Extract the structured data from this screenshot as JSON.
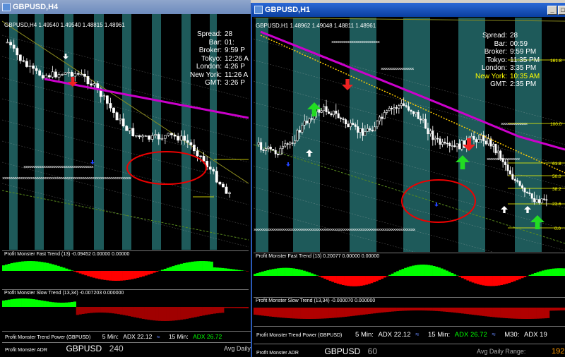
{
  "left_window": {
    "title": "GBPUSD,H4",
    "symbol_line": "GBPUSD,H4 1.49540 1.49540 1.48815 1.48961",
    "info": [
      {
        "label": "Spread:",
        "value": "28"
      },
      {
        "label": "Bar:",
        "value": "01:"
      },
      {
        "label": "Broker:",
        "value": "9:59 P"
      },
      {
        "label": "Tokyo:",
        "value": "12:26 A"
      },
      {
        "label": "London:",
        "value": "4:26 P"
      },
      {
        "label": "New York:",
        "value": "11:26 A"
      },
      {
        "label": "GMT:",
        "value": "3:26 P"
      }
    ],
    "fast_trend": {
      "label": "Profit Monster Fast Trend (13) -0.09452 0.00000 0.00000"
    },
    "slow_trend": {
      "label": "Profit Monster Slow Trend (13,34) -0.007203 0.000000"
    },
    "trend_power": {
      "label": "Profit Monster Trend Power (GBPUSD)",
      "m5": "5 Min:",
      "adx5": "ADX 22.12",
      "m15": "15 Min:",
      "adx15": "ADX 26.72"
    },
    "adr": {
      "label": "Profit Monster ADR",
      "symbol": "GBPUSD",
      "value": "240",
      "avg_label": "Avg Daily"
    }
  },
  "right_window": {
    "title": "GBPUSD,H1",
    "symbol_line": "GBPUSD,H1 1.48962 1.49048 1.48811 1.48961",
    "info": [
      {
        "label": "Spread:",
        "value": "28"
      },
      {
        "label": "Bar:",
        "value": "00:59"
      },
      {
        "label": "Broker:",
        "value": "9:59 PM"
      },
      {
        "label": "Tokyo:",
        "value": "11:35 PM"
      },
      {
        "label": "London:",
        "value": "3:35 PM"
      },
      {
        "label": "New York:",
        "value": "10:35 AM"
      },
      {
        "label": "GMT:",
        "value": "2:35 PM"
      }
    ],
    "fib_levels": [
      "161.8",
      "100.0",
      "61.8",
      "50.0",
      "38.2",
      "23.6",
      "0.0"
    ],
    "fast_trend": {
      "label": "Profit Monster Fast Trend (13) 0.20077 0.00000 0.00000"
    },
    "slow_trend": {
      "label": "Profit Monster Slow Trend (13,34) -0.000070 0.000000"
    },
    "trend_power": {
      "label": "Profit Monster Trend Power (GBPUSD)",
      "m5": "5 Min:",
      "adx5": "ADX 22.12",
      "m15": "15 Min:",
      "adx15": "ADX 26.72",
      "m30": "M30:",
      "adx30": "ADX 19"
    },
    "adr": {
      "label": "Profit Monster ADR",
      "symbol": "GBPUSD",
      "value": "60",
      "avg_label": "Avg Daily Range:",
      "avg_value": "192"
    }
  },
  "buttons": {
    "minimize": "_",
    "maximize": "□",
    "close": "×"
  },
  "colors": {
    "title_inactive": "#7a96c2",
    "title_active": "#0a3fa0",
    "teal_band": "#1e5a5a",
    "bull": "#00ff00",
    "bear": "#ff0000",
    "ema": "#cc00cc"
  }
}
